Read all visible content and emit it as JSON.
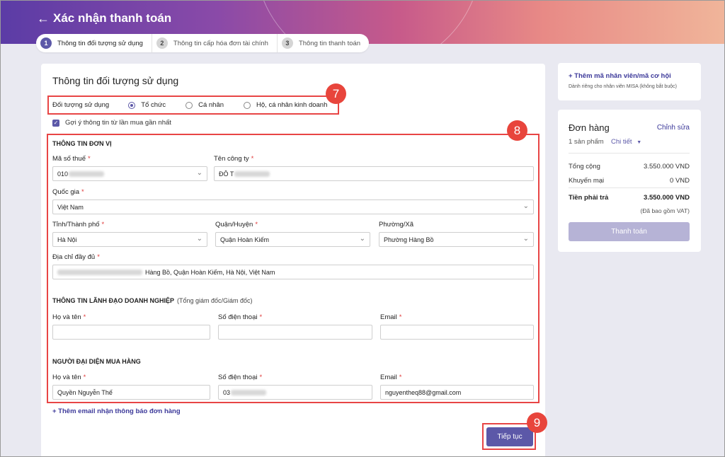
{
  "header": {
    "title": "Xác nhận thanh toán",
    "back_icon": "arrow-left-icon"
  },
  "stepper": {
    "steps": [
      {
        "num": "1",
        "label": "Thông tin đối tượng sử dụng"
      },
      {
        "num": "2",
        "label": "Thông tin cấp hóa đơn tài chính"
      },
      {
        "num": "3",
        "label": "Thông tin thanh toán"
      }
    ],
    "active_index": 0
  },
  "main": {
    "title": "Thông tin đối tượng sử dụng",
    "subject": {
      "label": "Đối tượng sử dụng",
      "options": [
        "Tổ chức",
        "Cá nhân",
        "Hộ, cá nhân kinh doanh"
      ],
      "selected": "Tổ chức"
    },
    "suggest_label": "Gợi ý thông tin từ lần mua gần nhất",
    "unit_section": {
      "title": "THÔNG TIN ĐƠN VỊ",
      "tax_code_label": "Mã số thuế",
      "tax_code_value": "010",
      "company_label": "Tên công ty",
      "company_value": "ĐÔ T",
      "country_label": "Quốc gia",
      "country_value": "Việt Nam",
      "province_label": "Tỉnh/Thành phố",
      "province_value": "Hà Nội",
      "district_label": "Quận/Huyện",
      "district_value": "Quận Hoàn Kiếm",
      "ward_label": "Phường/Xã",
      "ward_value": "Phường Hàng Bồ",
      "address_label": "Địa chỉ đầy đủ",
      "address_value": "Hàng Bồ, Quận Hoàn Kiếm, Hà Nội, Việt Nam"
    },
    "leader_section": {
      "title": "THÔNG TIN LÃNH ĐẠO DOANH NGHIỆP",
      "note": "(Tổng giám đốc/Giám đốc)",
      "name_label": "Họ và tên",
      "phone_label": "Số điện thoại",
      "email_label": "Email",
      "name_value": "",
      "phone_value": "",
      "email_value": ""
    },
    "buyer_section": {
      "title": "NGƯỜI ĐẠI DIỆN MUA HÀNG",
      "name_label": "Họ và tên",
      "phone_label": "Số điện thoại",
      "email_label": "Email",
      "name_value": "Quyền Nguyễn Thế",
      "phone_value": "03",
      "email_value": "nguyentheq88@gmail.com"
    },
    "add_email_label": "+ Thêm email nhận thông báo đơn hàng",
    "continue_label": "Tiếp tục",
    "required_mark": "*"
  },
  "promo": {
    "link": "+ Thêm mã nhân viên/mã cơ hội",
    "note": "Dành riêng cho nhân viên MISA (không bắt buộc)"
  },
  "order": {
    "title": "Đơn hàng",
    "edit_label": "Chỉnh sửa",
    "count": "1 sản phẩm",
    "detail_label": "Chi tiết",
    "total_label": "Tổng cộng",
    "total_value": "3.550.000 VND",
    "discount_label": "Khuyến mại",
    "discount_value": "0 VND",
    "payable_label": "Tiền phải trả",
    "payable_value": "3.550.000 VND",
    "vat_note": "(Đã bao gồm VAT)",
    "pay_label": "Thanh toán"
  },
  "annotations": {
    "badge_7": "7",
    "badge_8": "8",
    "badge_9": "9",
    "highlight_color": "#e84545"
  },
  "colors": {
    "accent": "#5c58a8",
    "link": "#3d3a9a",
    "required": "#e03b3b"
  }
}
